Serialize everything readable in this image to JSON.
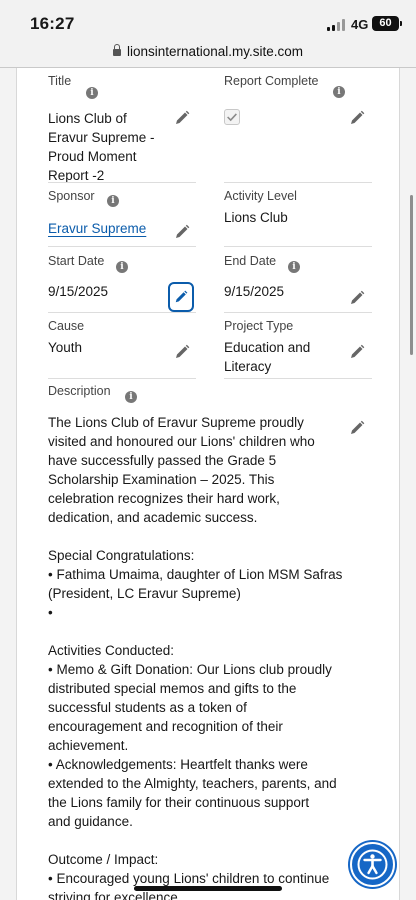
{
  "status_bar": {
    "time": "16:27",
    "network": "4G",
    "battery": "60"
  },
  "browser": {
    "url": "lionsinternational.my.site.com"
  },
  "fields": {
    "title": {
      "label": "Title",
      "value_lines": [
        "Lions Club of",
        "Eravur Supreme -",
        "Proud Moment",
        "Report -2"
      ]
    },
    "report_complete": {
      "label": "Report Complete",
      "checked": true
    },
    "sponsor": {
      "label": "Sponsor",
      "value": "Eravur Supreme"
    },
    "activity_level": {
      "label": "Activity Level",
      "value": "Lions Club"
    },
    "start_date": {
      "label": "Start Date",
      "value": "9/15/2025"
    },
    "end_date": {
      "label": "End Date",
      "value": "9/15/2025"
    },
    "cause": {
      "label": "Cause",
      "value": "Youth"
    },
    "project_type": {
      "label": "Project Type",
      "value_lines": [
        "Education and",
        "Literacy"
      ]
    },
    "description": {
      "label": "Description",
      "lines": [
        "The Lions Club of Eravur Supreme proudly",
        "visited and honoured our Lions' children who",
        "have successfully passed the Grade 5",
        "Scholarship Examination – 2025. This",
        "celebration recognizes their hard work,",
        "dedication, and academic success.",
        "",
        "Special Congratulations:",
        "• Fathima Umaima, daughter of Lion MSM Safras",
        "(President, LC Eravur Supreme)",
        "•",
        "",
        "Activities Conducted:",
        "• Memo & Gift Donation: Our Lions club proudly",
        "distributed special memos and gifts to the",
        "successful students as a token of",
        "encouragement and recognition of their",
        "achievement.",
        "• Acknowledgements: Heartfelt thanks were",
        "extended to the Almighty, teachers, parents, and",
        "the Lions family for their continuous support",
        "and guidance.",
        "",
        "Outcome / Impact:",
        "• Encouraged young Lions' children to continue",
        "striving for excellence."
      ]
    }
  },
  "icons": {
    "info": "i",
    "edit": "pencil-icon",
    "accessibility": "accessibility-icon"
  },
  "colors": {
    "link": "#0b5cab",
    "accent": "#1667c6",
    "pencil": "#666666"
  }
}
